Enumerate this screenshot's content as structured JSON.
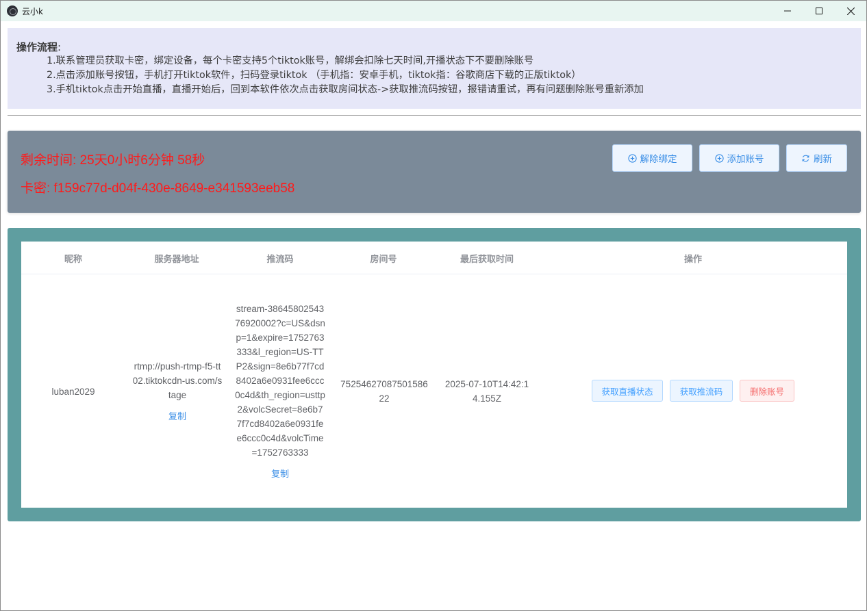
{
  "window": {
    "title": "云小k",
    "controls": [
      "minimize",
      "maximize",
      "close"
    ]
  },
  "instructions": {
    "title": "操作流程",
    "title_suffix": ":",
    "steps": [
      "1.联系管理员获取卡密，绑定设备，每个卡密支持5个tiktok账号，解绑会扣除七天时间,开播状态下不要删除账号",
      "2.点击添加账号按钮，手机打开tiktok软件，扫码登录tiktok （手机指：安卓手机，tiktok指：谷歌商店下载的正版tiktok）",
      "3.手机tiktok点击开始直播，直播开始后，回到本软件依次点击获取房间状态->获取推流码按钮，报错请重试，再有问题删除账号重新添加"
    ]
  },
  "info": {
    "remaining_time": "剩余时间: 25天0小时6分钟 58秒",
    "card_key": "卡密: f159c77d-d04f-430e-8649-e341593eeb58",
    "buttons": {
      "unbind": "解除绑定",
      "add_account": "添加账号",
      "refresh": "刷新"
    }
  },
  "table": {
    "columns": [
      "昵称",
      "服务器地址",
      "推流码",
      "房间号",
      "最后获取时间",
      "操作"
    ],
    "rows": [
      {
        "nickname": "luban2029",
        "server": "rtmp://push-rtmp-f5-tt02.tiktokcdn-us.com/stage",
        "server_copy": "复制",
        "stream_key": "stream-3864580254376920002?c=US&dsnp=1&expire=1752763333&l_region=US-TTP2&sign=8e6b77f7cd8402a6e0931fee6ccc0c4d&th_region=usttp2&volcSecret=8e6b77f7cd8402a6e0931fee6ccc0c4d&volcTime=1752763333",
        "stream_copy": "复制",
        "room_id": "7525462708750158622",
        "last_fetch": "2025-07-10T14:42:14.155Z",
        "actions": {
          "get_status": "获取直播状态",
          "get_stream": "获取推流码",
          "delete": "删除账号"
        }
      }
    ]
  },
  "colors": {
    "titlebar": "#e8f5f1",
    "instructions_bg": "#e6e7f8",
    "info_bg": "#7b8a99",
    "alert_text": "#ff1a1a",
    "table_frame": "#5f9ea0",
    "primary": "#409eff",
    "danger": "#f56c6c"
  }
}
